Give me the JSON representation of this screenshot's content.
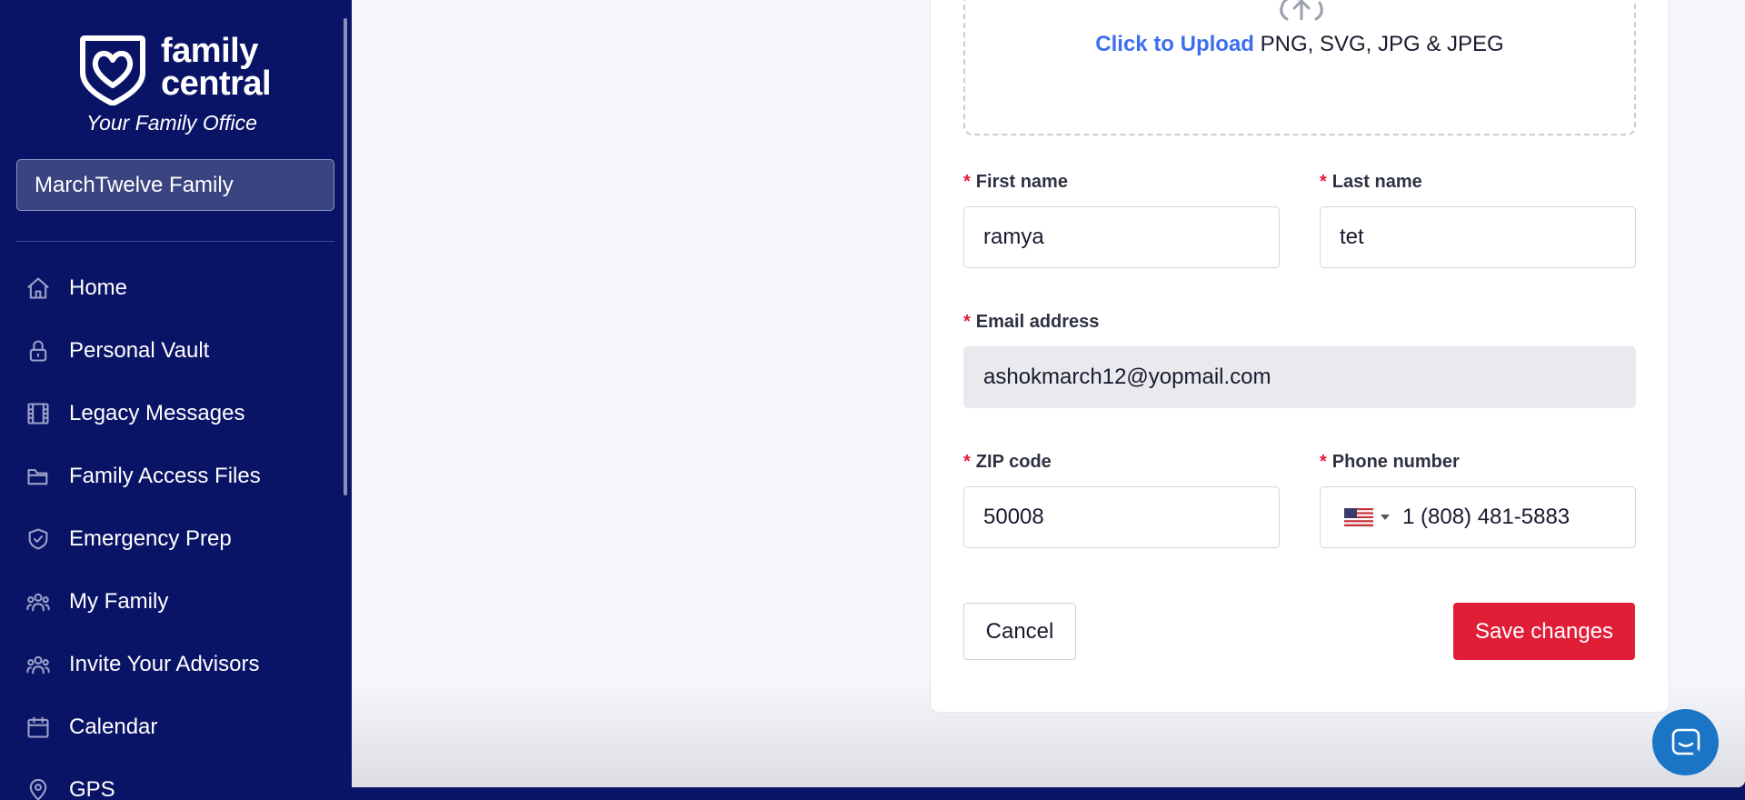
{
  "brand": {
    "name_line1": "family",
    "name_line2": "central",
    "tagline": "Your Family Office"
  },
  "family_selector": {
    "value": "MarchTwelve Family"
  },
  "sidebar": {
    "items": [
      {
        "label": "Home",
        "icon": "home-icon"
      },
      {
        "label": "Personal Vault",
        "icon": "lock-icon"
      },
      {
        "label": "Legacy Messages",
        "icon": "film-icon"
      },
      {
        "label": "Family Access Files",
        "icon": "folder-icon"
      },
      {
        "label": "Emergency Prep",
        "icon": "shield-check-icon"
      },
      {
        "label": "My Family",
        "icon": "users-icon"
      },
      {
        "label": "Invite Your Advisors",
        "icon": "users-icon"
      },
      {
        "label": "Calendar",
        "icon": "calendar-icon"
      },
      {
        "label": "GPS",
        "icon": "map-pin-icon"
      }
    ]
  },
  "upload": {
    "link_text": "Click to Upload",
    "formats": "PNG, SVG, JPG & JPEG"
  },
  "form": {
    "first_name": {
      "label": "First name",
      "value": "ramya",
      "required": "*"
    },
    "last_name": {
      "label": "Last name",
      "value": "tet",
      "required": "*"
    },
    "email": {
      "label": "Email address",
      "value": "ashokmarch12@yopmail.com",
      "required": "*"
    },
    "zip": {
      "label": "ZIP code",
      "value": "50008",
      "required": "*"
    },
    "phone": {
      "label": "Phone number",
      "value": "1 (808) 481-5883",
      "country": "US",
      "required": "*"
    }
  },
  "actions": {
    "cancel_label": "Cancel",
    "save_label": "Save changes"
  },
  "colors": {
    "sidebar_bg": "#0a1466",
    "accent_red": "#e11d38",
    "link_blue": "#3d6ef0",
    "chat_blue": "#1b75c6"
  }
}
